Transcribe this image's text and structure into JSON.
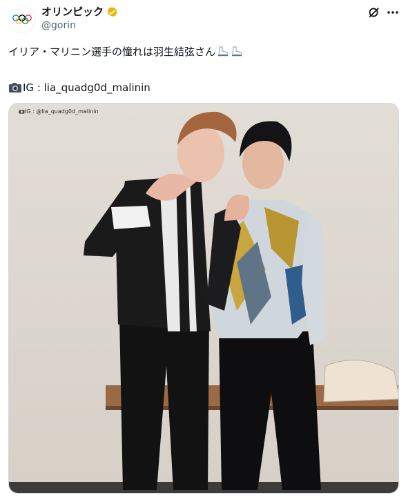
{
  "header": {
    "display_name": "オリンピック",
    "handle": "@gorin",
    "avatar_icon": "olympic-rings-icon",
    "verified_icon": "verified-badge-icon",
    "verified_color": "#e8b600",
    "grok_icon": "grok-icon",
    "more_icon": "more-icon"
  },
  "tweet": {
    "text_line1": "イリア・マリニン選手の憧れは羽生結弦さん",
    "emoji_skates": "ice-skate-icon",
    "text_line2": "IG : lia_quadg0d_malinin",
    "emoji_camera": "camera-icon"
  },
  "media": {
    "watermark": "IG : @lia_quadg0d_malinin"
  },
  "colors": {
    "text": "#0f1419",
    "secondary_text": "#536471",
    "border": "#cfd9de"
  }
}
